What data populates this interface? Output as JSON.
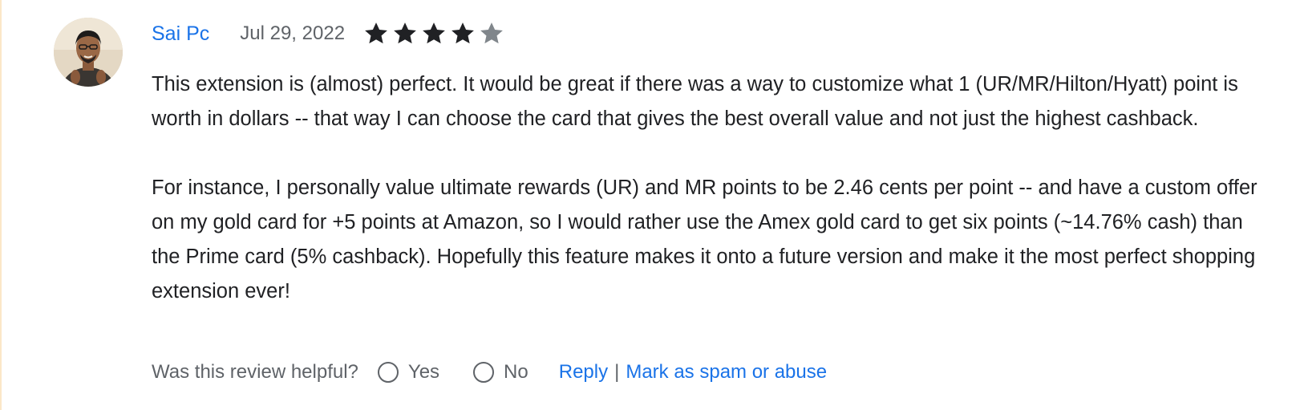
{
  "review": {
    "author": "Sai Pc",
    "date": "Jul 29, 2022",
    "rating": 4,
    "rating_max": 5,
    "paragraphs": [
      "This extension is (almost) perfect. It would be great if there was a way to customize what 1 (UR/MR/Hilton/Hyatt) point is worth in dollars -- that way I can choose the card that gives the best overall value and not just the highest cashback.",
      "For instance, I personally value ultimate rewards (UR) and MR points to be 2.46 cents per point -- and have a custom offer on my gold card for +5 points at Amazon, so I would rather use the Amex gold card to get six points (~14.76% cash) than the Prime card (5% cashback). Hopefully this feature makes it onto a future version and make it the most perfect shopping extension ever!"
    ]
  },
  "footer": {
    "helpful_prompt": "Was this review helpful?",
    "yes_label": "Yes",
    "no_label": "No",
    "reply_label": "Reply",
    "separator": "|",
    "spam_label": "Mark as spam or abuse"
  },
  "icons": {
    "star_filled": "star-icon",
    "star_empty": "star-empty-icon",
    "avatar": "user-avatar"
  },
  "colors": {
    "link": "#1a73e8",
    "text": "#202124",
    "muted": "#5f6368",
    "star_filled": "#202124",
    "star_empty": "#80868b"
  }
}
